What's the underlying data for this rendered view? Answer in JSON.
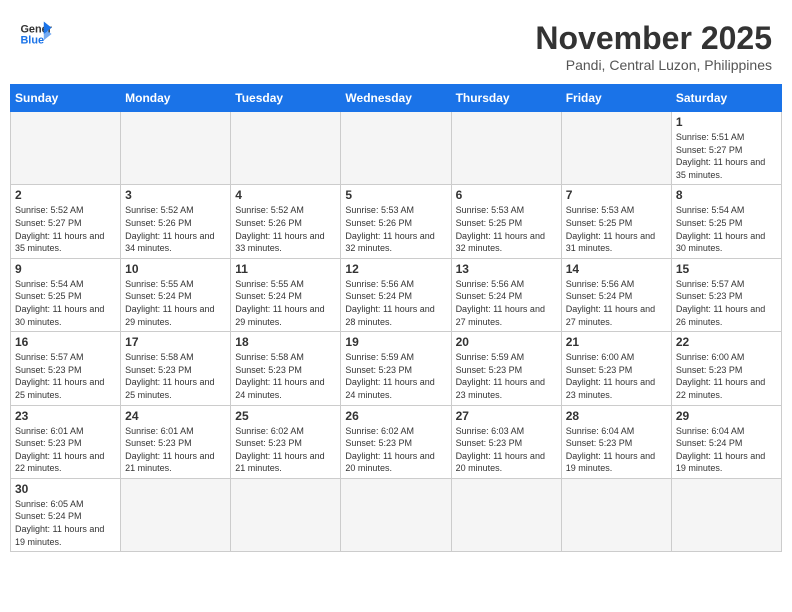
{
  "header": {
    "logo_line1": "General",
    "logo_line2": "Blue",
    "month_title": "November 2025",
    "location": "Pandi, Central Luzon, Philippines"
  },
  "days_of_week": [
    "Sunday",
    "Monday",
    "Tuesday",
    "Wednesday",
    "Thursday",
    "Friday",
    "Saturday"
  ],
  "weeks": [
    [
      {
        "day": "",
        "info": ""
      },
      {
        "day": "",
        "info": ""
      },
      {
        "day": "",
        "info": ""
      },
      {
        "day": "",
        "info": ""
      },
      {
        "day": "",
        "info": ""
      },
      {
        "day": "",
        "info": ""
      },
      {
        "day": "1",
        "info": "Sunrise: 5:51 AM\nSunset: 5:27 PM\nDaylight: 11 hours\nand 35 minutes."
      }
    ],
    [
      {
        "day": "2",
        "info": "Sunrise: 5:52 AM\nSunset: 5:27 PM\nDaylight: 11 hours\nand 35 minutes."
      },
      {
        "day": "3",
        "info": "Sunrise: 5:52 AM\nSunset: 5:26 PM\nDaylight: 11 hours\nand 34 minutes."
      },
      {
        "day": "4",
        "info": "Sunrise: 5:52 AM\nSunset: 5:26 PM\nDaylight: 11 hours\nand 33 minutes."
      },
      {
        "day": "5",
        "info": "Sunrise: 5:53 AM\nSunset: 5:26 PM\nDaylight: 11 hours\nand 32 minutes."
      },
      {
        "day": "6",
        "info": "Sunrise: 5:53 AM\nSunset: 5:25 PM\nDaylight: 11 hours\nand 32 minutes."
      },
      {
        "day": "7",
        "info": "Sunrise: 5:53 AM\nSunset: 5:25 PM\nDaylight: 11 hours\nand 31 minutes."
      },
      {
        "day": "8",
        "info": "Sunrise: 5:54 AM\nSunset: 5:25 PM\nDaylight: 11 hours\nand 30 minutes."
      }
    ],
    [
      {
        "day": "9",
        "info": "Sunrise: 5:54 AM\nSunset: 5:25 PM\nDaylight: 11 hours\nand 30 minutes."
      },
      {
        "day": "10",
        "info": "Sunrise: 5:55 AM\nSunset: 5:24 PM\nDaylight: 11 hours\nand 29 minutes."
      },
      {
        "day": "11",
        "info": "Sunrise: 5:55 AM\nSunset: 5:24 PM\nDaylight: 11 hours\nand 29 minutes."
      },
      {
        "day": "12",
        "info": "Sunrise: 5:56 AM\nSunset: 5:24 PM\nDaylight: 11 hours\nand 28 minutes."
      },
      {
        "day": "13",
        "info": "Sunrise: 5:56 AM\nSunset: 5:24 PM\nDaylight: 11 hours\nand 27 minutes."
      },
      {
        "day": "14",
        "info": "Sunrise: 5:56 AM\nSunset: 5:24 PM\nDaylight: 11 hours\nand 27 minutes."
      },
      {
        "day": "15",
        "info": "Sunrise: 5:57 AM\nSunset: 5:23 PM\nDaylight: 11 hours\nand 26 minutes."
      }
    ],
    [
      {
        "day": "16",
        "info": "Sunrise: 5:57 AM\nSunset: 5:23 PM\nDaylight: 11 hours\nand 25 minutes."
      },
      {
        "day": "17",
        "info": "Sunrise: 5:58 AM\nSunset: 5:23 PM\nDaylight: 11 hours\nand 25 minutes."
      },
      {
        "day": "18",
        "info": "Sunrise: 5:58 AM\nSunset: 5:23 PM\nDaylight: 11 hours\nand 24 minutes."
      },
      {
        "day": "19",
        "info": "Sunrise: 5:59 AM\nSunset: 5:23 PM\nDaylight: 11 hours\nand 24 minutes."
      },
      {
        "day": "20",
        "info": "Sunrise: 5:59 AM\nSunset: 5:23 PM\nDaylight: 11 hours\nand 23 minutes."
      },
      {
        "day": "21",
        "info": "Sunrise: 6:00 AM\nSunset: 5:23 PM\nDaylight: 11 hours\nand 23 minutes."
      },
      {
        "day": "22",
        "info": "Sunrise: 6:00 AM\nSunset: 5:23 PM\nDaylight: 11 hours\nand 22 minutes."
      }
    ],
    [
      {
        "day": "23",
        "info": "Sunrise: 6:01 AM\nSunset: 5:23 PM\nDaylight: 11 hours\nand 22 minutes."
      },
      {
        "day": "24",
        "info": "Sunrise: 6:01 AM\nSunset: 5:23 PM\nDaylight: 11 hours\nand 21 minutes."
      },
      {
        "day": "25",
        "info": "Sunrise: 6:02 AM\nSunset: 5:23 PM\nDaylight: 11 hours\nand 21 minutes."
      },
      {
        "day": "26",
        "info": "Sunrise: 6:02 AM\nSunset: 5:23 PM\nDaylight: 11 hours\nand 20 minutes."
      },
      {
        "day": "27",
        "info": "Sunrise: 6:03 AM\nSunset: 5:23 PM\nDaylight: 11 hours\nand 20 minutes."
      },
      {
        "day": "28",
        "info": "Sunrise: 6:04 AM\nSunset: 5:23 PM\nDaylight: 11 hours\nand 19 minutes."
      },
      {
        "day": "29",
        "info": "Sunrise: 6:04 AM\nSunset: 5:24 PM\nDaylight: 11 hours\nand 19 minutes."
      }
    ],
    [
      {
        "day": "30",
        "info": "Sunrise: 6:05 AM\nSunset: 5:24 PM\nDaylight: 11 hours\nand 19 minutes."
      },
      {
        "day": "",
        "info": ""
      },
      {
        "day": "",
        "info": ""
      },
      {
        "day": "",
        "info": ""
      },
      {
        "day": "",
        "info": ""
      },
      {
        "day": "",
        "info": ""
      },
      {
        "day": "",
        "info": ""
      }
    ]
  ]
}
